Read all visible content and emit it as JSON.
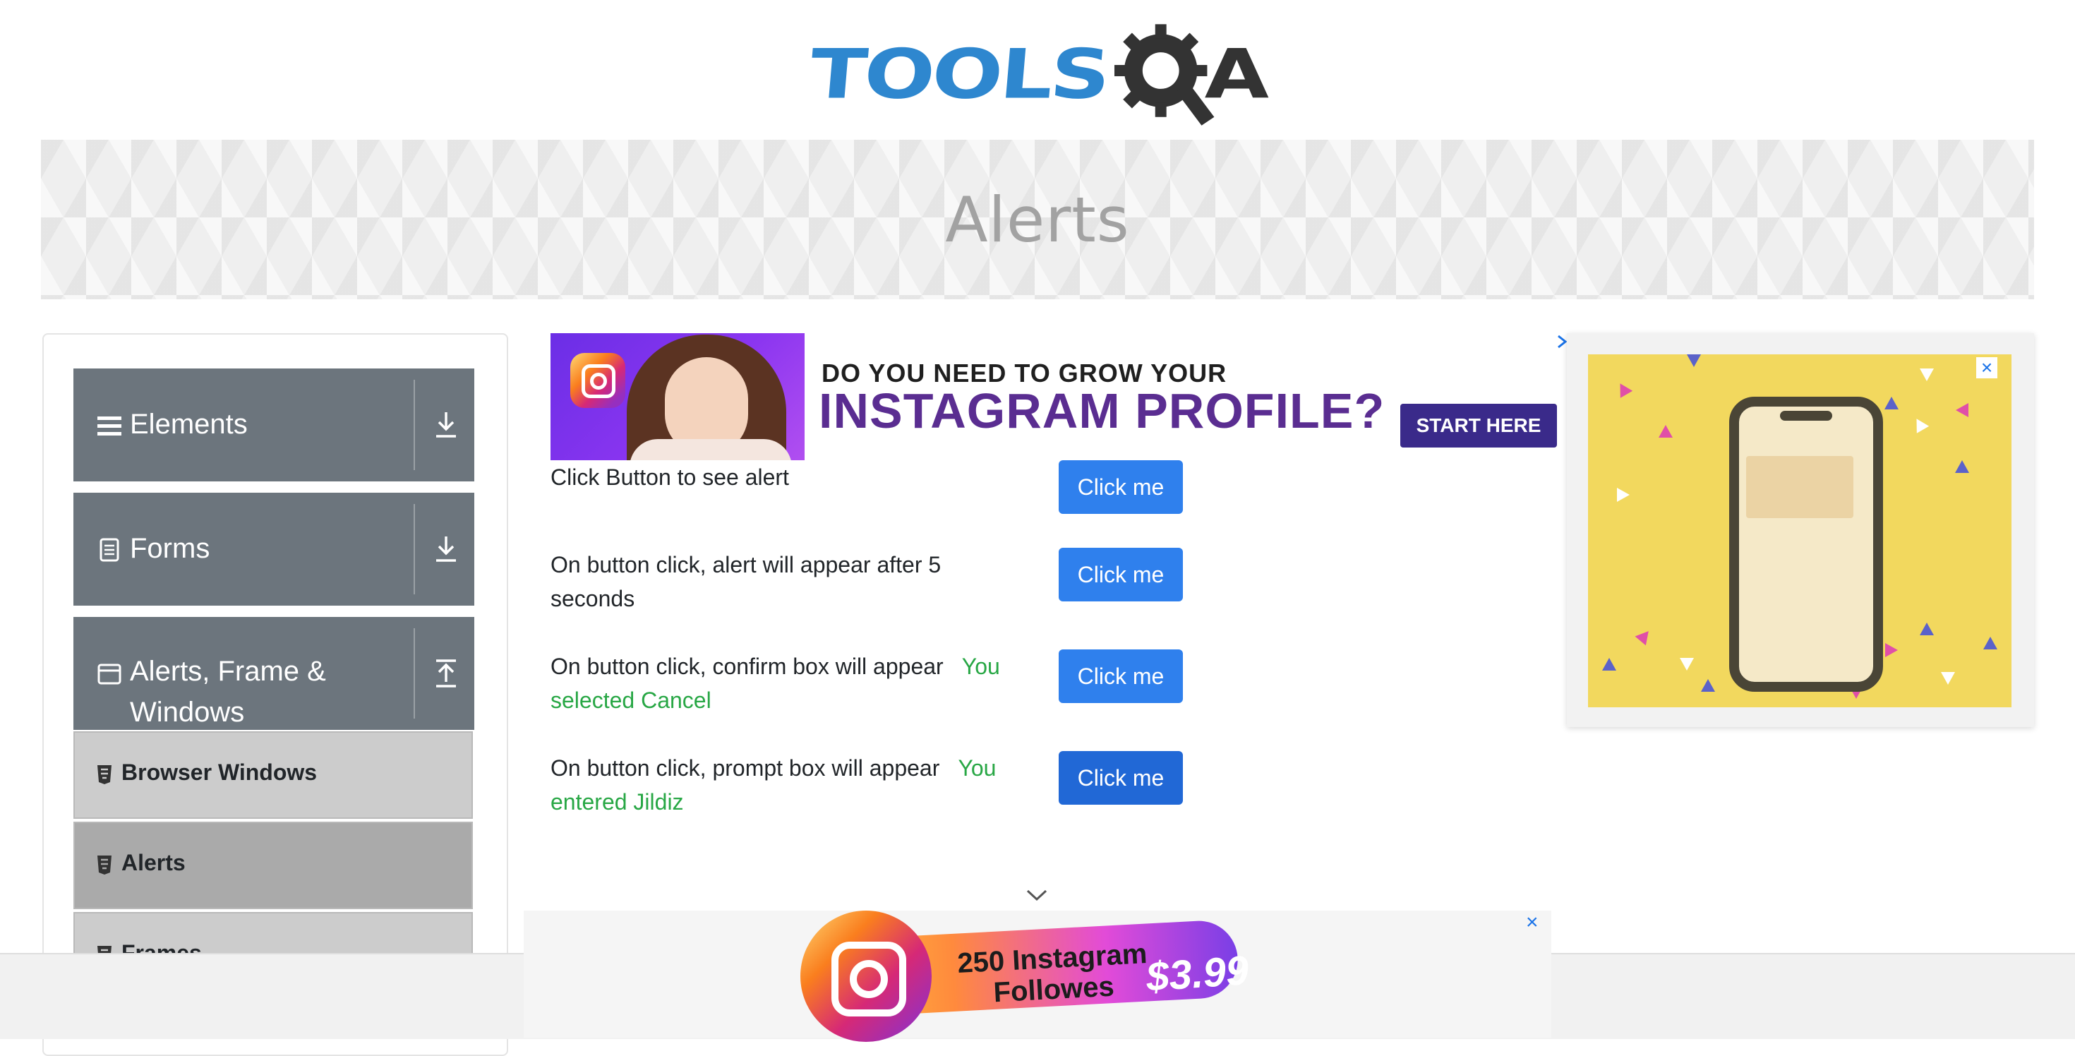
{
  "logo": {
    "text_left": "TOOLS",
    "text_right": "A",
    "colors": {
      "tools": "#2e87cf",
      "qa": "#333333"
    }
  },
  "banner": {
    "title": "Alerts"
  },
  "sidebar": {
    "groups": [
      {
        "label": "Elements",
        "icon": "hamburger-icon",
        "toggle": "download-icon"
      },
      {
        "label": "Forms",
        "icon": "document-icon",
        "toggle": "download-icon"
      },
      {
        "label": "Alerts, Frame & Windows",
        "icon": "window-icon",
        "toggle": "upload-icon"
      }
    ],
    "items": [
      {
        "label": "Browser Windows",
        "icon": "html5-icon",
        "active": false
      },
      {
        "label": "Alerts",
        "icon": "html5-icon",
        "active": true
      },
      {
        "label": "Frames",
        "icon": "html5-icon",
        "active": false
      }
    ]
  },
  "ad_top": {
    "line1": "DO YOU NEED TO GROW YOUR",
    "line2": "INSTAGRAM PROFILE?",
    "cta": "START HERE",
    "choice_icon": "ad-choices-icon"
  },
  "alerts": [
    {
      "label": "Click Button to see alert",
      "result": "",
      "button": "Click me"
    },
    {
      "label": "On button click, alert will appear after 5 seconds",
      "result": "",
      "button": "Click me"
    },
    {
      "label": "On button click, confirm box will appear",
      "result": "You selected Cancel",
      "button": "Click me"
    },
    {
      "label": "On button click, prompt box will appear",
      "result": "You entered Jildiz",
      "button": "Click me"
    }
  ],
  "ad_bottom": {
    "line1": "250 Instagram",
    "line2": "Followes",
    "price": "$3.99"
  },
  "colors": {
    "button": "#2f80ed",
    "result_text": "#28a745",
    "sidebar_header": "#6c757d",
    "sidebar_item": "#cccccc",
    "sidebar_item_active": "#aaaaaa"
  }
}
